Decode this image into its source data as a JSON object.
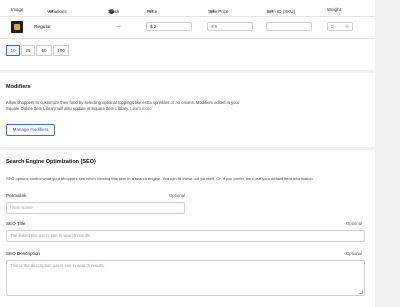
{
  "variations": {
    "columns": {
      "image": "Image",
      "variations": "Variations",
      "stock": "Stock",
      "price": "Price",
      "sale_price": "Sale Price",
      "item_id": "Item ID (SKU)",
      "weight": "Weight"
    },
    "row": {
      "name": "Regular",
      "stock": "—",
      "price_prefix": "$",
      "price_value": "2",
      "sale_prefix": "$",
      "sale_placeholder": "0",
      "sku_placeholder": "",
      "weight_placeholder": "0",
      "weight_unit": "lb"
    },
    "page_sizes": [
      "10",
      "25",
      "50",
      "100"
    ],
    "page_size_selected": "10"
  },
  "modifiers": {
    "title": "Modifiers",
    "description": "Allow shoppers to customize their food by selecting optional toppings like extra sprinkles or no onions. Modifiers edited in your Square Online Item Library will also update in Square Item Library.",
    "learn_more": "Learn more",
    "manage_button": "Manage modifiers"
  },
  "seo": {
    "title": "Search Engine Optimization (SEO)",
    "description": "SEO options control what your shoppers see when viewing this item in a search engine. You can fill these out yourself. Or, if you prefer, we'll use your default item information.",
    "permalink_label": "Permalink",
    "permalink_optional": "Optional",
    "permalink_placeholder": "/ item-name",
    "seo_title_label": "SEO Title",
    "seo_title_optional": "Optional",
    "seo_title_placeholder": "The linked title users see in search results.",
    "seo_desc_label": "SEO Description",
    "seo_desc_optional": "Optional",
    "seo_desc_placeholder": "This is the description users see in search results."
  },
  "colors": {
    "accent": "#3b6cc4",
    "background": "#f0f0f0",
    "card": "#ffffff"
  },
  "icons": {
    "sort": "sort-arrows-icon",
    "info": "info-icon",
    "thumbnail": "item-thumbnail"
  }
}
